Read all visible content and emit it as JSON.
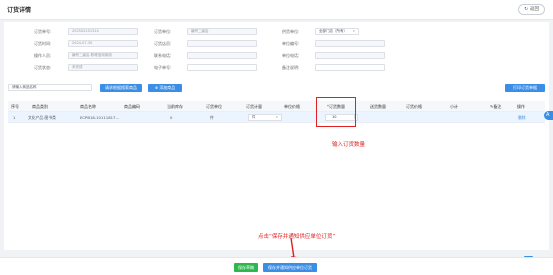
{
  "header": {
    "title": "订货详情",
    "back_label": "返回"
  },
  "form": {
    "rows": [
      [
        {
          "label": "订货单号:",
          "value": "202502251314",
          "style": "grey"
        },
        {
          "label": "订货单位:",
          "value": "编号二级店",
          "style": "grey"
        },
        {
          "label": "供货单位:",
          "value": "全部门店（所有）",
          "style": "white",
          "dropdown": true
        }
      ],
      [
        {
          "label": "订货时间:",
          "value": "2024-07-30",
          "style": "grey"
        },
        {
          "label": "订货店员:",
          "value": "",
          "style": "grey"
        },
        {
          "label": "单位编号:",
          "value": "",
          "style": "grey"
        }
      ],
      [
        {
          "label": "操作人员:",
          "value": "编号二级店-陈唯信用用用",
          "style": "grey"
        },
        {
          "label": "联系电话:",
          "value": "",
          "style": "grey"
        },
        {
          "label": "单位电话:",
          "value": "",
          "style": "grey"
        }
      ],
      [
        {
          "label": "订货状态:",
          "value": "未完成",
          "style": "grey"
        },
        {
          "label": "电子单号:",
          "value": "",
          "style": "white"
        },
        {
          "label": "备注说明:",
          "value": "",
          "style": "white"
        }
      ]
    ]
  },
  "toolbar": {
    "search_placeholder": "请输入商品名称",
    "search_button": "请求根据搜索商品",
    "add_button": "添加商品",
    "export_button": "打印订货单据"
  },
  "table": {
    "columns": [
      "序号",
      "商品类别",
      "商品名称",
      "商品编码",
      "当前库存",
      "订货单位",
      "订货计量",
      "单位价格",
      "订货数量",
      "送货数量",
      "订货价格",
      "小计",
      "备注",
      "操作"
    ],
    "rows": [
      {
        "index": "1",
        "category": "文化产品-图书类",
        "name": "ECPB18-10111817...",
        "code": "",
        "stock": "0",
        "unit": "件",
        "measure": "件",
        "price": "",
        "qty": "10",
        "delivered": "",
        "order_price": "",
        "subtotal": "",
        "remark": "",
        "action": "删除"
      }
    ]
  },
  "annotations": {
    "qty_note": "输入订货数量",
    "save_note": "点击“保存并通知供应单位订货”"
  },
  "pager": {
    "page": "1"
  },
  "bottom": {
    "save_label": "保存草稿",
    "notify_label": "保存并通知供应单位订货"
  },
  "side_badge": "A"
}
